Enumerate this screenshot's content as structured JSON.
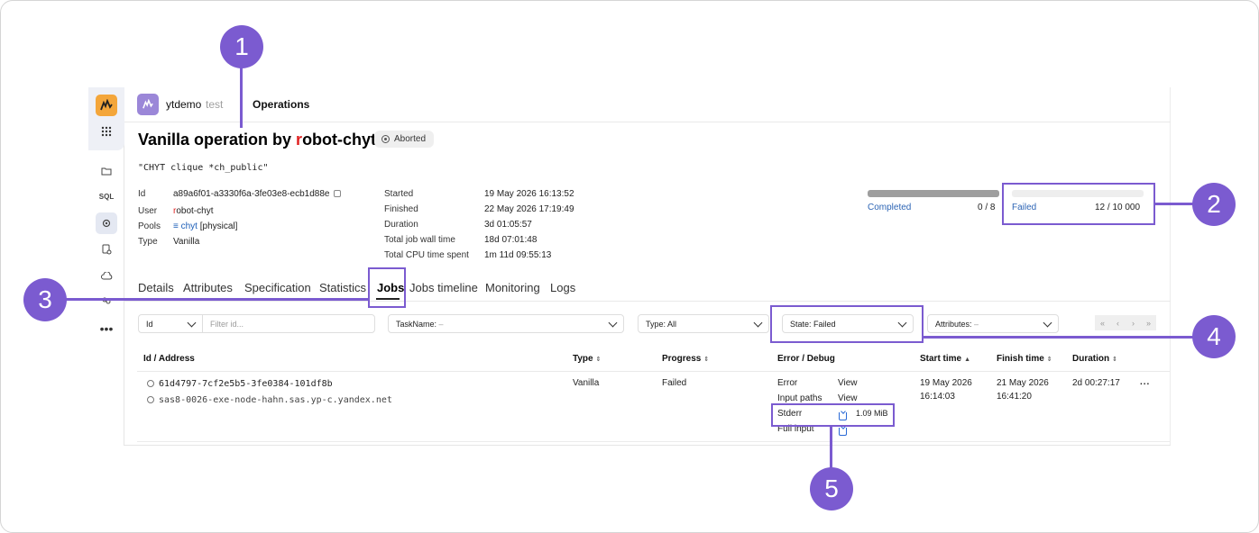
{
  "header": {
    "cluster_name": "ytdemo",
    "cluster_env": "test",
    "section": "Operations"
  },
  "operation": {
    "title_prefix": "Vanilla operation by ",
    "title_user_first": "r",
    "title_user_rest": "obot-chyt",
    "state": "Aborted",
    "query": "\"CHYT clique *ch_public\""
  },
  "meta_left": [
    {
      "label": "Id",
      "value": "a89a6f01-a3330f6a-3fe03e8-ecb1d88e"
    },
    {
      "label": "User",
      "value_first": "r",
      "value_rest": "obot-chyt"
    },
    {
      "label": "Pools",
      "value_link": "chyt",
      "value_tail": "[physical]"
    },
    {
      "label": "Type",
      "value": "Vanilla"
    }
  ],
  "meta_right": [
    {
      "label": "Started",
      "value": "19 May 2026 16:13:52"
    },
    {
      "label": "Finished",
      "value": "22 May 2026 17:19:49"
    },
    {
      "label": "Duration",
      "value": "3d 01:05:57"
    },
    {
      "label": "Total job wall time",
      "value": "18d 07:01:48"
    },
    {
      "label": "Total CPU time spent",
      "value": "1m 11d 09:55:13"
    }
  ],
  "progress": {
    "completed": {
      "label": "Completed",
      "value": "0 / 8",
      "fraction": 1.0
    },
    "failed": {
      "label": "Failed",
      "value": "12 / 10 000",
      "fraction": 0.0
    }
  },
  "tabs": [
    "Details",
    "Attributes",
    "Specification",
    "Statistics",
    "Jobs",
    "Jobs timeline",
    "Monitoring",
    "Logs"
  ],
  "active_tab": "Jobs",
  "filters": {
    "id_select": "Id",
    "id_placeholder": "Filter id...",
    "task_name": "TaskName:",
    "task_name_value": "–",
    "type": "Type: All",
    "state": "State: Failed",
    "attributes": "Attributes:",
    "attributes_value": "–",
    "pager": [
      "«",
      "‹",
      "›",
      "»"
    ]
  },
  "table": {
    "headers": [
      "Id / Address",
      "Type",
      "Progress",
      "Error / Debug",
      "Start time",
      "Finish time",
      "Duration"
    ],
    "rows": [
      {
        "id": "61d4797-7cf2e5b5-3fe0384-101df8b",
        "address": "sas8-0026-exe-node-hahn.sas.yp-c.yandex.net",
        "type": "Vanilla",
        "progress": "Failed",
        "debug": [
          {
            "label": "Error",
            "action": "View"
          },
          {
            "label": "Input paths",
            "action": "View"
          },
          {
            "label": "Stderr",
            "size": "1.09 MiB"
          },
          {
            "label": "Full input"
          }
        ],
        "start_date": "19 May 2026",
        "start_time": "16:14:03",
        "finish_date": "21 May 2026",
        "finish_time": "16:41:20",
        "duration": "2d 00:27:17",
        "more": "..."
      }
    ]
  },
  "callouts": [
    "1",
    "2",
    "3",
    "4",
    "5"
  ],
  "colors": {
    "accent": "#7b5bd0",
    "logo": "#f4a63a",
    "user_highlight": "#e02020",
    "link": "#1d5fb8"
  }
}
